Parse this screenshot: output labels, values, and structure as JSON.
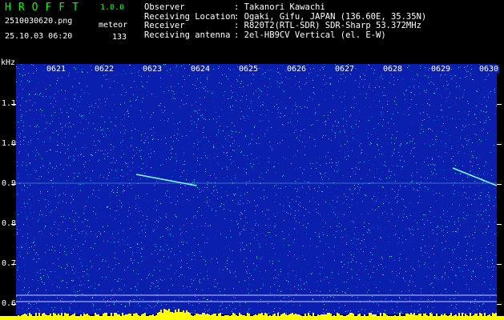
{
  "app": {
    "title": "HROFFT",
    "version": "1.0.0"
  },
  "file": {
    "name": "2510030620.png",
    "timestamp": "25.10.03 06:20"
  },
  "detection": {
    "label": "meteor",
    "count": "133"
  },
  "station": [
    {
      "key": "Observer",
      "value": ": Takanori Kawachi"
    },
    {
      "key": "Receiving Location",
      "value": ": Ogaki, Gifu, JAPAN (136.60E, 35.35N)"
    },
    {
      "key": "Receiver",
      "value": ": R820T2(RTL-SDR) SDR-Sharp 53.372MHz"
    },
    {
      "key": "Receiving antenna",
      "value": ": 2el-HB9CV Vertical (el. E-W)"
    }
  ],
  "axis": {
    "unit": "kHz",
    "minutes": [
      "0621",
      "0622",
      "0623",
      "0624",
      "0625",
      "0626",
      "0627",
      "0628",
      "0629",
      "0630"
    ],
    "freq_labels": [
      "1.1",
      "1.0",
      "0.9",
      "0.8",
      "0.7",
      "0.6"
    ]
  },
  "colors": {
    "background": "#0b1fae",
    "text": "#ffffff",
    "title": "#00ff00",
    "noise_bright": "#2ec8ff",
    "signal": "#7fffff",
    "yellow": "#ffff00"
  }
}
